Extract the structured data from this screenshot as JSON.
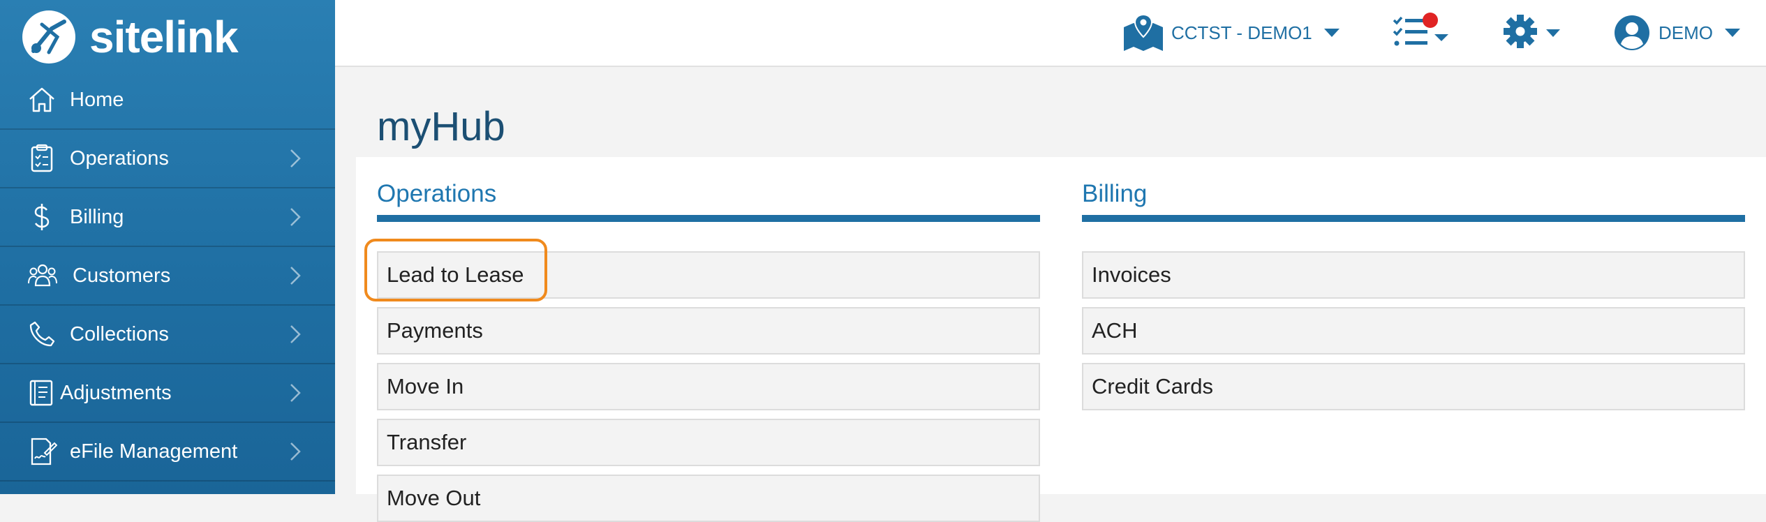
{
  "app": {
    "logo_text": "sitelink"
  },
  "sidebar": {
    "items": [
      {
        "label": "Home",
        "icon": "home-icon",
        "has_chevron": false
      },
      {
        "label": "Operations",
        "icon": "clipboard-icon",
        "has_chevron": true
      },
      {
        "label": "Billing",
        "icon": "dollar-icon",
        "has_chevron": true
      },
      {
        "label": "Customers",
        "icon": "users-icon",
        "has_chevron": true
      },
      {
        "label": "Collections",
        "icon": "phone-icon",
        "has_chevron": true
      },
      {
        "label": "Adjustments",
        "icon": "ledger-icon",
        "has_chevron": true
      },
      {
        "label": "eFile Management",
        "icon": "file-signature-icon",
        "has_chevron": true
      }
    ]
  },
  "header": {
    "location_label": "CCTST - DEMO1",
    "tasks_icon": "task-list-icon",
    "settings_icon": "gear-icon",
    "user_label": "DEMO",
    "notification_color": "#e02424"
  },
  "main": {
    "title": "myHub",
    "operations": {
      "title": "Operations",
      "items": [
        "Lead to Lease",
        "Payments",
        "Move In",
        "Transfer",
        "Move Out"
      ]
    },
    "billing": {
      "title": "Billing",
      "items": [
        "Invoices",
        "ACH",
        "Credit Cards"
      ]
    }
  },
  "colors": {
    "sidebar_bg": "#1f6fa3",
    "accent": "#1f77b0",
    "highlight": "#f08a1d"
  }
}
